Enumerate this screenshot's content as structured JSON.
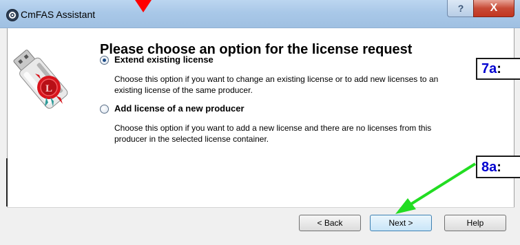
{
  "window": {
    "title": "CmFAS Assistant",
    "help_glyph": "?",
    "close_glyph": "X"
  },
  "main": {
    "heading": "Please choose an option for the license request"
  },
  "options": [
    {
      "label": "Extend existing license",
      "selected": true,
      "desc_line1": "Choose this option if you want to change an existing license or to add new licenses to an",
      "desc_line2": "existing license of the same producer."
    },
    {
      "label": "Add license of a new producer",
      "selected": false,
      "desc_line1": "Choose this option if you want to add a new license and there are no licenses from this",
      "desc_line2": "producer in the selected license container."
    }
  ],
  "buttons": {
    "back": "< Back",
    "next": "Next >",
    "help": "Help"
  },
  "annotations": {
    "a7": "7a",
    "a8": "8a",
    "colon": ":"
  },
  "colors": {
    "arrow_red": "#ff0000",
    "arrow_green": "#22dd22",
    "annotation_blue": "#0000d0"
  },
  "icons": [
    "cmfas-app-icon",
    "usb-license-key-icon",
    "red-arrow-icon",
    "green-arrow-icon"
  ]
}
